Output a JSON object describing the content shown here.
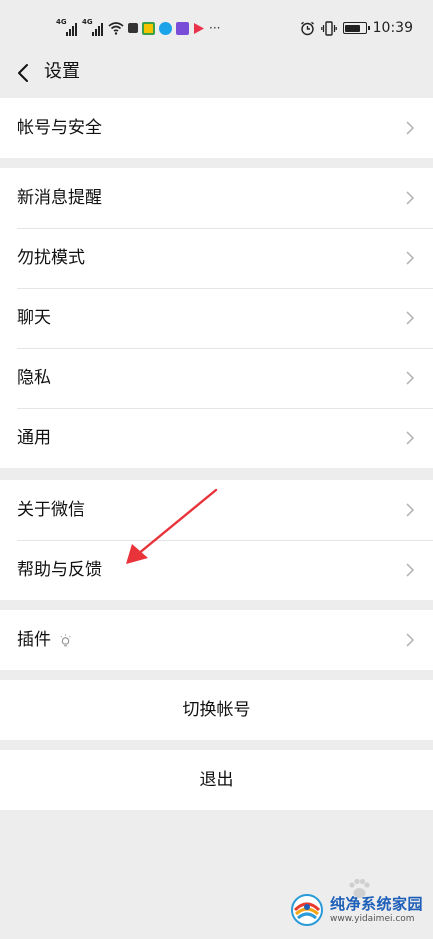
{
  "status_bar": {
    "net1": "4G",
    "net2": "4G",
    "time": "10:39",
    "battery_level": 0.8
  },
  "nav": {
    "title": "设置"
  },
  "groups": {
    "account": {
      "account_security": "帐号与安全"
    },
    "prefs": {
      "new_message": "新消息提醒",
      "do_not_disturb": "勿扰模式",
      "chat": "聊天",
      "privacy": "隐私",
      "general": "通用"
    },
    "about": {
      "about_wechat": "关于微信",
      "help_feedback": "帮助与反馈"
    },
    "plugins": {
      "plugins": "插件"
    },
    "switch": {
      "switch_account": "切换帐号"
    },
    "logout": {
      "logout": "退出"
    }
  },
  "watermark": {
    "name": "纯净系统家园",
    "url": "www.yidaimei.com"
  },
  "colors": {
    "background": "#ededed",
    "row_bg": "#ffffff",
    "divider": "#e5e5e5",
    "annotation_arrow": "#e8333a",
    "watermark_blue": "#1d5fb8"
  },
  "icons": [
    "back-chevron-icon",
    "chevron-right-icon",
    "plugin-bulb-icon",
    "wifi-icon",
    "alarm-icon",
    "vibrate-icon",
    "battery-icon"
  ]
}
